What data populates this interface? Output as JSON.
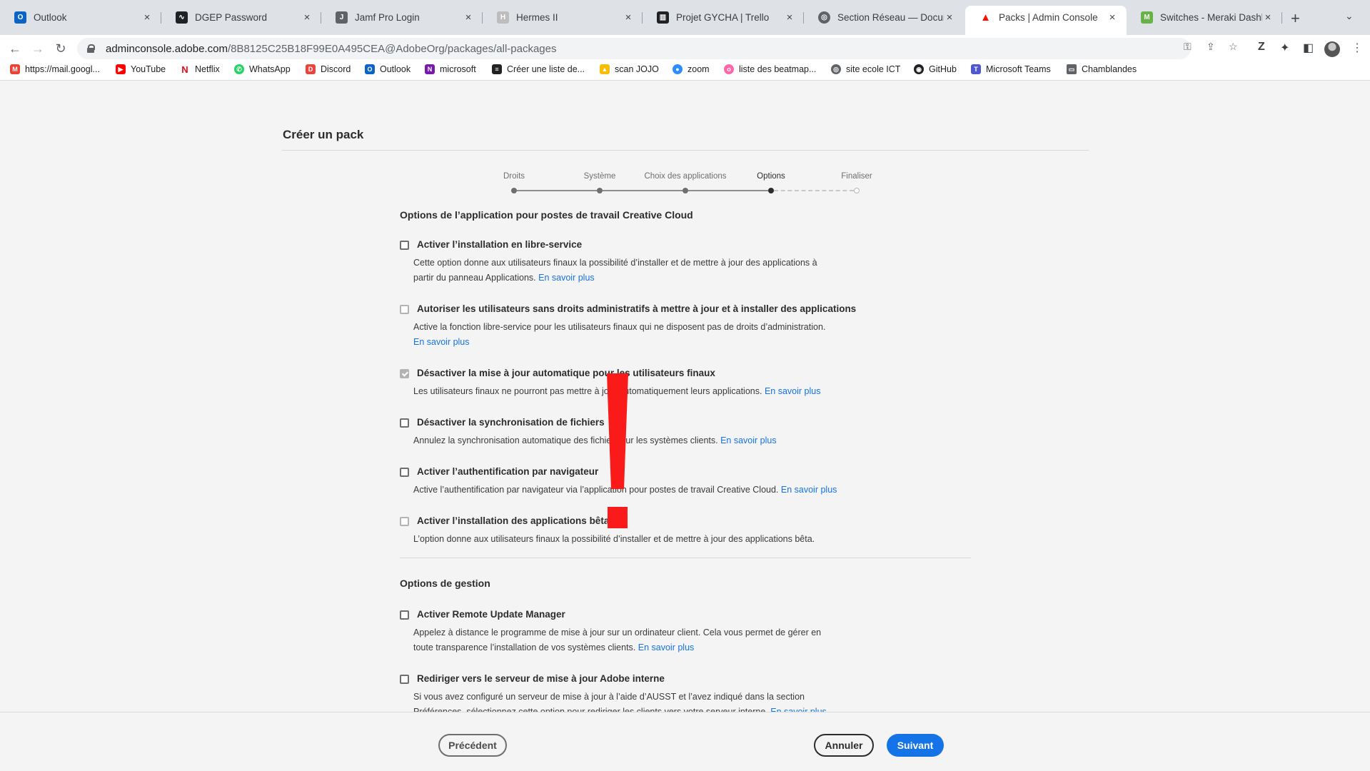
{
  "browser": {
    "tabs": [
      {
        "title": "Outlook",
        "icon": "outlook-icon",
        "color": "#0a64c8"
      },
      {
        "title": "DGEP Password",
        "icon": "waveform-icon",
        "color": "#202124"
      },
      {
        "title": "Jamf Pro Login",
        "icon": "jamf-icon",
        "color": "#5f6368"
      },
      {
        "title": "Hermes II",
        "icon": "hermes-icon",
        "color": "#bdbdbd"
      },
      {
        "title": "Projet GYCHA | Trello",
        "icon": "trello-icon",
        "color": "#202124"
      },
      {
        "title": "Section Réseau — Documen",
        "icon": "globe-icon",
        "color": "#5f6368"
      },
      {
        "title": "Packs | Admin Console",
        "icon": "adobe-icon",
        "color": "#fa0f00"
      },
      {
        "title": "Switches - Meraki Dashboar",
        "icon": "meraki-icon",
        "color": "#67b346"
      }
    ],
    "url_host": "adminconsole.adobe.com",
    "url_path": "/8B8125C25B18F99E0A495CEA@AdobeOrg/packages/all-packages",
    "bookmarks": [
      {
        "label": "https://mail.googl...",
        "icon": "gmail-icon",
        "color": "#ea4335"
      },
      {
        "label": "YouTube",
        "icon": "youtube-icon",
        "color": "#ff0000"
      },
      {
        "label": "Netflix",
        "icon": "netflix-icon",
        "color": "#e50914"
      },
      {
        "label": "WhatsApp",
        "icon": "whatsapp-icon",
        "color": "#25d366"
      },
      {
        "label": "Discord",
        "icon": "discord-icon",
        "color": "#e8453c"
      },
      {
        "label": "Outlook",
        "icon": "outlook-icon",
        "color": "#0a64c8"
      },
      {
        "label": "microsoft",
        "icon": "onenote-icon",
        "color": "#7719aa"
      },
      {
        "label": "Créer une liste de...",
        "icon": "list-icon",
        "color": "#222222"
      },
      {
        "label": "scan JOJO",
        "icon": "drive-icon",
        "color": "#fbbc04"
      },
      {
        "label": "zoom",
        "icon": "zoom-icon",
        "color": "#2d8cff"
      },
      {
        "label": "liste des beatmap...",
        "icon": "osu-icon",
        "color": "#ff66aa"
      },
      {
        "label": "site ecole ICT",
        "icon": "globe-icon",
        "color": "#5f6368"
      },
      {
        "label": "GitHub",
        "icon": "github-icon",
        "color": "#202124"
      },
      {
        "label": "Microsoft Teams",
        "icon": "teams-icon",
        "color": "#5059c9"
      },
      {
        "label": "Chamblandes",
        "icon": "folder-icon",
        "color": "#5f6368"
      }
    ]
  },
  "page": {
    "title": "Créer un pack",
    "steps": [
      {
        "label": "Droits",
        "state": "done"
      },
      {
        "label": "Système",
        "state": "done"
      },
      {
        "label": "Choix des applications",
        "state": "done"
      },
      {
        "label": "Options",
        "state": "current"
      },
      {
        "label": "Finaliser",
        "state": "pending"
      }
    ],
    "app_section_title": "Options de l’application pour postes de travail Creative Cloud",
    "link_text": "En savoir plus",
    "app_options": [
      {
        "label": "Activer l’installation en libre-service",
        "desc_line1": "Cette option donne aux utilisateurs finaux la possibilité d’installer et de mettre à jour des applications à",
        "desc_line2": "partir du panneau Applications.",
        "checked": false,
        "disabled": false
      },
      {
        "label": "Autoriser les utilisateurs sans droits administratifs à mettre à jour et à installer des applications",
        "desc_line1": "Active la fonction libre-service pour les utilisateurs finaux qui ne disposent pas de droits d’administration.",
        "desc_line2": "",
        "checked": false,
        "disabled": true
      },
      {
        "label": "Désactiver la mise à jour automatique pour les utilisateurs finaux",
        "desc_line1": "Les utilisateurs finaux ne pourront pas mettre à jour automatiquement leurs applications.",
        "desc_line2": "",
        "checked": true,
        "disabled": true
      },
      {
        "label": "Désactiver la synchronisation de fichiers",
        "desc_line1": "Annulez la synchronisation automatique des fichiers sur les systèmes clients.",
        "desc_line2": "",
        "checked": false,
        "disabled": false
      },
      {
        "label": "Activer l’authentification par navigateur",
        "desc_line1": "Active l’authentification par navigateur via l’application pour postes de travail Creative Cloud.",
        "desc_line2": "",
        "checked": false,
        "disabled": false
      },
      {
        "label": "Activer l’installation des applications bêta",
        "desc_line1": "L’option donne aux utilisateurs finaux la possibilité d’installer et de mettre à jour des applications bêta.",
        "desc_line2": "",
        "checked": false,
        "disabled": true
      }
    ],
    "mgmt_section_title": "Options de gestion",
    "mgmt_options": [
      {
        "label": "Activer Remote Update Manager",
        "desc_line1": "Appelez à distance le programme de mise à jour sur un ordinateur client. Cela vous permet de gérer en",
        "desc_line2": "toute transparence l’installation de vos systèmes clients.",
        "checked": false,
        "disabled": false
      },
      {
        "label": "Rediriger vers le serveur de mise à jour Adobe interne",
        "desc_line1": "Si vous avez configuré un serveur de mise à jour à l’aide d’AUSST et l’avez indiqué dans la section",
        "desc_line2": "Préférences, sélectionnez cette option pour rediriger les clients vers votre serveur interne.",
        "checked": false,
        "disabled": false
      }
    ],
    "buttons": {
      "previous": "Précédent",
      "cancel": "Annuler",
      "next": "Suivant"
    }
  },
  "colors": {
    "accent": "#1473e6",
    "annotation": "#fa1a1a"
  }
}
